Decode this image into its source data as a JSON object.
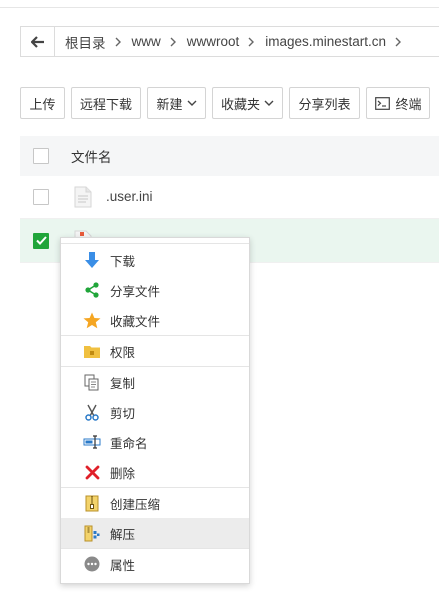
{
  "breadcrumb": {
    "items": [
      "根目录",
      "www",
      "wwwroot",
      "images.minestart.cn"
    ]
  },
  "toolbar": {
    "upload": "上传",
    "remote_download": "远程下载",
    "new": "新建",
    "favorites": "收藏夹",
    "share_list": "分享列表",
    "terminal": "终端"
  },
  "table": {
    "header_name": "文件名",
    "rows": [
      {
        "name": ".user.ini",
        "checked": false
      },
      {
        "name": "",
        "checked": true
      }
    ]
  },
  "context_menu": {
    "items": [
      {
        "label": "下载",
        "icon": "download-arrow-icon"
      },
      {
        "label": "分享文件",
        "icon": "share-icon"
      },
      {
        "label": "收藏文件",
        "icon": "star-icon"
      },
      {
        "label": "权限",
        "icon": "folder-lock-icon"
      },
      {
        "label": "复制",
        "icon": "copy-icon"
      },
      {
        "label": "剪切",
        "icon": "scissors-icon"
      },
      {
        "label": "重命名",
        "icon": "rename-icon"
      },
      {
        "label": "删除",
        "icon": "delete-x-icon"
      },
      {
        "label": "创建压缩",
        "icon": "archive-icon"
      },
      {
        "label": "解压",
        "icon": "extract-icon"
      },
      {
        "label": "属性",
        "icon": "properties-icon"
      }
    ],
    "highlighted": "解压"
  },
  "colors": {
    "accent": "#20a53a",
    "selected_row": "#eaf6ef",
    "delete_red": "#e0202a",
    "download_blue": "#3a8ee6",
    "star_orange": "#f5a623"
  }
}
